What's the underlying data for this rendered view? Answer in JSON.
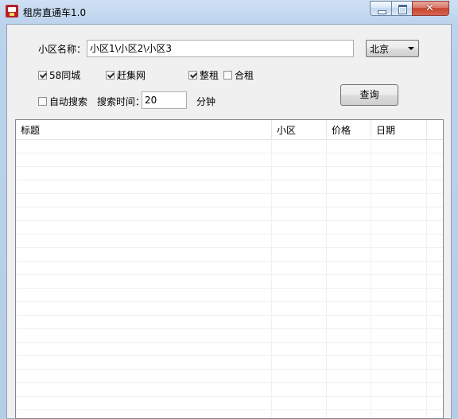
{
  "window": {
    "title": "租房直通车1.0",
    "close_glyph": "✕"
  },
  "search": {
    "community_label": "小区名称：",
    "community_value": "小区1\\小区2\\小区3",
    "city_value": "北京"
  },
  "sources": [
    {
      "label": "58同城",
      "checked": true
    },
    {
      "label": "赶集网",
      "checked": true
    }
  ],
  "rent_types": [
    {
      "label": "整租",
      "checked": true
    },
    {
      "label": "合租",
      "checked": false
    }
  ],
  "auto": {
    "auto_search_label": "自动搜索",
    "auto_search_checked": false,
    "interval_label": "搜索时间：",
    "interval_value": "20",
    "unit_label": "分钟"
  },
  "buttons": {
    "query_label": "查询"
  },
  "table": {
    "columns": [
      "标题",
      "小区",
      "价格",
      "日期"
    ],
    "rows": []
  }
}
